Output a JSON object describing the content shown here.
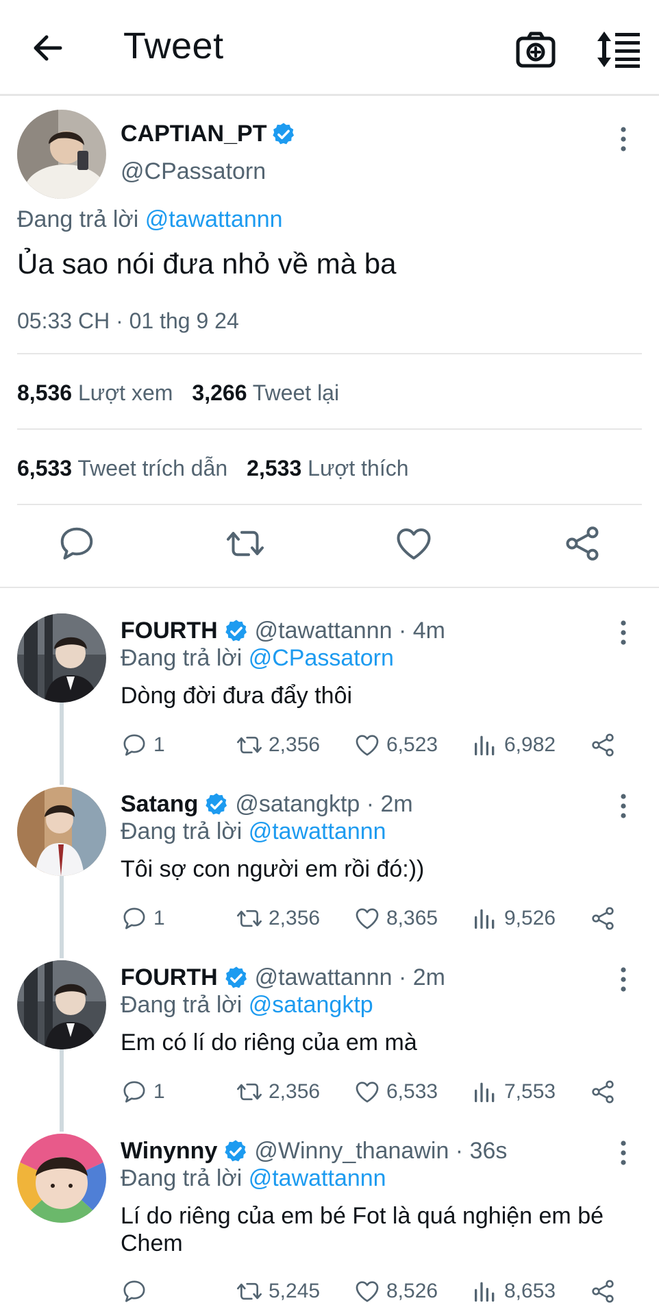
{
  "header": {
    "title": "Tweet"
  },
  "colors": {
    "accent": "#1d9bf0",
    "muted": "#536471",
    "text": "#0f1419",
    "divider": "#e6e6e6"
  },
  "main_tweet": {
    "name": "CAPTIAN_PT",
    "handle": "@CPassatorn",
    "reply_prefix": "Đang trả lời",
    "reply_mention": "@tawattannn",
    "text": "Ủa sao nói đưa nhỏ về mà ba",
    "timestamp": "05:33 CH · 01 thg 9 24",
    "stats": {
      "views": "8,536",
      "views_label": "Lượt xem",
      "retweets": "3,266",
      "retweets_label": "Tweet lại",
      "quotes": "6,533",
      "quotes_label": "Tweet trích dẫn",
      "likes": "2,533",
      "likes_label": "Lượt thích"
    }
  },
  "replies": [
    {
      "name": "FOURTH",
      "verified": true,
      "handle": "@tawattannn · 4m",
      "reply_prefix": "Đang trả lời",
      "reply_mention": "@CPassatorn",
      "text": "Dòng đời đưa đẩy thôi",
      "comments": "1",
      "retweets": "2,356",
      "likes": "6,523",
      "views": "6,982"
    },
    {
      "name": "Satang",
      "verified": true,
      "handle": "@satangktp · 2m",
      "reply_prefix": "Đang trả lời",
      "reply_mention": "@tawattannn",
      "text": "Tôi sợ con người em rồi đó:))",
      "comments": "1",
      "retweets": "2,356",
      "likes": "8,365",
      "views": "9,526"
    },
    {
      "name": "FOURTH",
      "verified": true,
      "handle": "@tawattannn · 2m",
      "reply_prefix": "Đang trả lời",
      "reply_mention": "@satangktp",
      "text": "Em có lí do riêng của em mà",
      "comments": "1",
      "retweets": "2,356",
      "likes": "6,533",
      "views": "7,553"
    },
    {
      "name": "Winynny",
      "verified": true,
      "handle": "@Winny_thanawin · 36s",
      "reply_prefix": "Đang trả lời",
      "reply_mention": "@tawattannn",
      "text": "Lí do riêng của em bé Fot là quá nghiện em bé Chem",
      "comments": "",
      "retweets": "5,245",
      "likes": "8,526",
      "views": "8,653"
    }
  ]
}
